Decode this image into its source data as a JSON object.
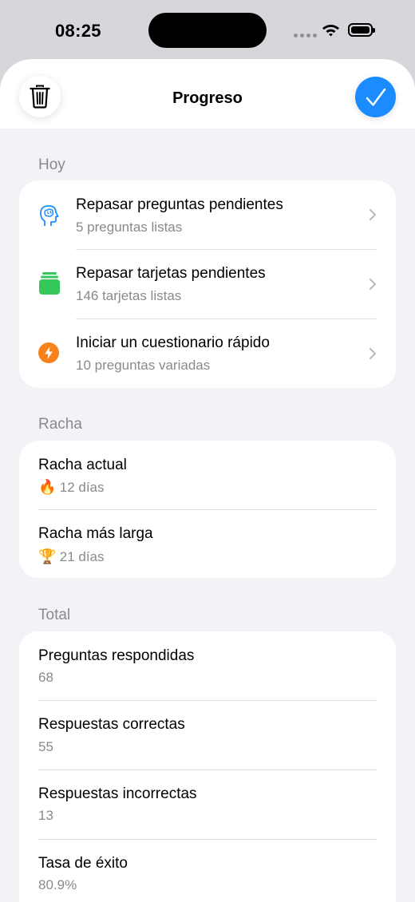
{
  "status_bar": {
    "time": "08:25"
  },
  "header": {
    "title": "Progreso"
  },
  "today": {
    "label": "Hoy",
    "items": [
      {
        "title": "Repasar preguntas pendientes",
        "subtitle": "5 preguntas listas",
        "icon": "brain-head-icon"
      },
      {
        "title": "Repasar tarjetas pendientes",
        "subtitle": "146 tarjetas listas",
        "icon": "cards-stack-icon"
      },
      {
        "title": "Iniciar un cuestionario rápido",
        "subtitle": "10 preguntas variadas",
        "icon": "bolt-icon"
      }
    ]
  },
  "streak": {
    "label": "Racha",
    "items": [
      {
        "title": "Racha actual",
        "emoji": "🔥",
        "value": "12 días"
      },
      {
        "title": "Racha más larga",
        "emoji": "🏆",
        "value": "21 días"
      }
    ]
  },
  "total": {
    "label": "Total",
    "items": [
      {
        "title": "Preguntas respondidas",
        "value": "68"
      },
      {
        "title": "Respuestas correctas",
        "value": "55"
      },
      {
        "title": "Respuestas incorrectas",
        "value": "13"
      },
      {
        "title": "Tasa de éxito",
        "value": "80.9%"
      }
    ]
  },
  "colors": {
    "accent": "#1a8cff",
    "green": "#34c759",
    "orange": "#f7821b",
    "background": "#f2f2f7"
  }
}
